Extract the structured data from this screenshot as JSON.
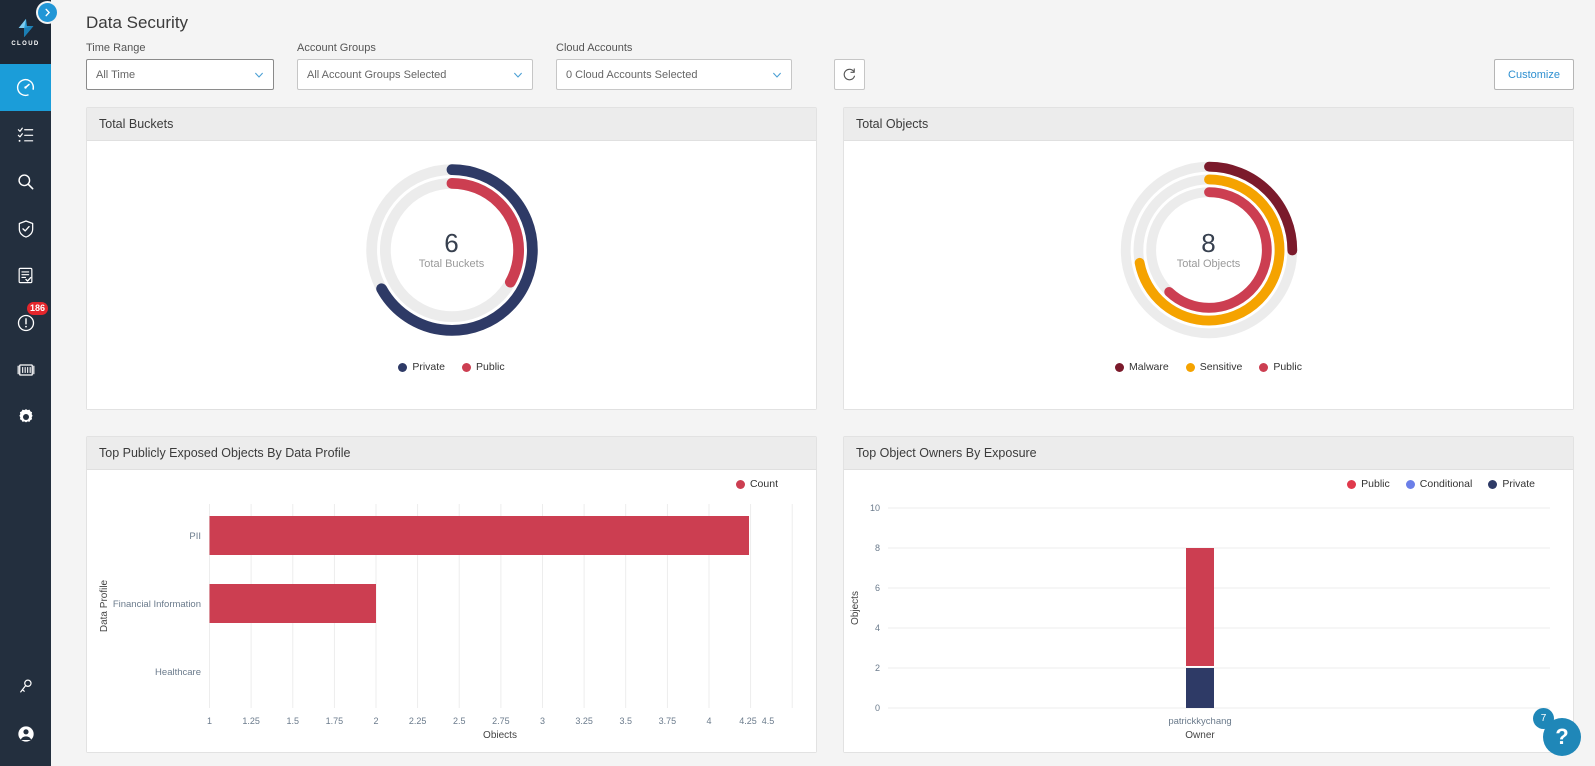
{
  "app": {
    "logo_text": "CLOUD",
    "collapse_icon": "chevron-right-icon"
  },
  "sidebar": {
    "items": [
      {
        "name": "dashboard",
        "icon": "gauge-icon",
        "active": true,
        "badge": ""
      },
      {
        "name": "inventory",
        "icon": "list-checklist-icon",
        "active": false,
        "badge": ""
      },
      {
        "name": "investigate",
        "icon": "search-icon",
        "active": false,
        "badge": ""
      },
      {
        "name": "compliance",
        "icon": "shield-check-icon",
        "active": false,
        "badge": ""
      },
      {
        "name": "reports",
        "icon": "document-check-icon",
        "active": false,
        "badge": ""
      },
      {
        "name": "alerts",
        "icon": "alert-circle-icon",
        "active": false,
        "badge": "186"
      },
      {
        "name": "containers",
        "icon": "container-icon",
        "active": false,
        "badge": ""
      },
      {
        "name": "settings",
        "icon": "gear-icon",
        "active": false,
        "badge": ""
      }
    ],
    "bottom_items": [
      {
        "name": "access-keys",
        "icon": "key-icon"
      },
      {
        "name": "user-account",
        "icon": "user-circle-icon"
      }
    ]
  },
  "header": {
    "title": "Data Security"
  },
  "filters": {
    "time_range": {
      "label": "Time Range",
      "value": "All Time"
    },
    "account_groups": {
      "label": "Account Groups",
      "value": "All Account Groups Selected"
    },
    "cloud_accounts": {
      "label": "Cloud Accounts",
      "value": "0 Cloud Accounts Selected"
    },
    "refresh_icon": "refresh-icon",
    "customize_label": "Customize"
  },
  "panels": {
    "total_buckets": {
      "title": "Total Buckets"
    },
    "total_objects": {
      "title": "Total Objects"
    },
    "top_exposed": {
      "title": "Top Publicly Exposed Objects By Data Profile"
    },
    "top_owners": {
      "title": "Top Object Owners By Exposure"
    }
  },
  "help": {
    "icon": "question-mark-icon",
    "label": "?",
    "badge": "7"
  },
  "colors": {
    "navy": "#2e3a66",
    "crimson": "#cc3e51",
    "maroon": "#7b1a2b",
    "orange": "#f5a300",
    "periwinkle": "#6b7fe8",
    "track": "#ececec",
    "accent": "#2d8fd0"
  },
  "chart_data": [
    {
      "type": "pie",
      "name": "total-buckets-donut",
      "title": "Total Buckets",
      "center_value": "6",
      "center_label": "Total Buckets",
      "total": 6,
      "legend_position": "bottom",
      "rings": [
        {
          "name": "Private",
          "value": 4,
          "total": 6,
          "fraction": 0.67,
          "color": "#2e3a66",
          "ring": "outer"
        },
        {
          "name": "Public",
          "value": 2,
          "total": 6,
          "fraction": 0.33,
          "color": "#cc3e51",
          "ring": "inner"
        }
      ],
      "legend": [
        "Private",
        "Public"
      ]
    },
    {
      "type": "pie",
      "name": "total-objects-donut",
      "title": "Total Objects",
      "center_value": "8",
      "center_label": "Total Objects",
      "total": 8,
      "legend_position": "bottom",
      "rings": [
        {
          "name": "Malware",
          "value": 2,
          "total": 8,
          "fraction": 0.25,
          "color": "#7b1a2b",
          "ring": "outer"
        },
        {
          "name": "Sensitive",
          "value": 6,
          "total": 8,
          "fraction": 0.72,
          "color": "#f5a300",
          "ring": "middle"
        },
        {
          "name": "Public",
          "value": 5,
          "total": 8,
          "fraction": 0.62,
          "color": "#cc3e51",
          "ring": "inner"
        }
      ],
      "legend": [
        "Malware",
        "Sensitive",
        "Public"
      ]
    },
    {
      "type": "bar",
      "name": "top-publicly-exposed-objects-by-data-profile",
      "orientation": "horizontal",
      "title": "Top Publicly Exposed Objects By Data Profile",
      "xlabel": "Objects",
      "ylabel": "Data Profile",
      "categories": [
        "PII",
        "Financial Information",
        "Healthcare"
      ],
      "series": [
        {
          "name": "Count",
          "color": "#cc3e51",
          "values": [
            4,
            2,
            0
          ]
        }
      ],
      "xlim": [
        1,
        4.5
      ],
      "xticks": [
        "1",
        "1.25",
        "1.5",
        "1.75",
        "2",
        "2.25",
        "2.5",
        "2.75",
        "3",
        "3.25",
        "3.5",
        "3.75",
        "4",
        "4.25",
        "4.5"
      ],
      "grid": true,
      "legend": [
        "Count"
      ],
      "legend_position": "top-right"
    },
    {
      "type": "bar",
      "name": "top-object-owners-by-exposure",
      "orientation": "vertical",
      "stacked": true,
      "title": "Top Object Owners By Exposure",
      "xlabel": "Owner",
      "ylabel": "Objects",
      "categories": [
        "patrickkychang"
      ],
      "series": [
        {
          "name": "Public",
          "color": "#cc3e51",
          "values": [
            6
          ]
        },
        {
          "name": "Conditional",
          "color": "#6b7fe8",
          "values": [
            0
          ]
        },
        {
          "name": "Private",
          "color": "#2e3a66",
          "values": [
            2
          ]
        }
      ],
      "ylim": [
        0,
        10
      ],
      "yticks": [
        "0",
        "2",
        "4",
        "6",
        "8",
        "10"
      ],
      "grid": true,
      "legend": [
        "Public",
        "Conditional",
        "Private"
      ],
      "legend_position": "top-right"
    }
  ]
}
